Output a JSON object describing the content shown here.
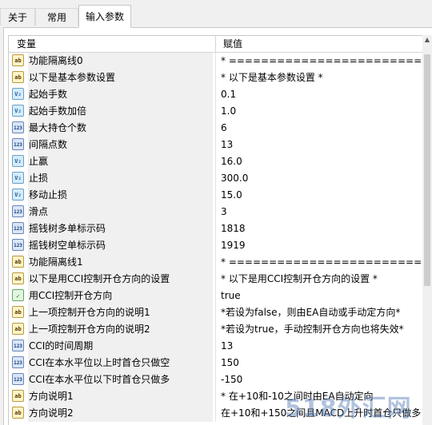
{
  "tabs": [
    {
      "label": "关于"
    },
    {
      "label": "常用"
    },
    {
      "label": "输入参数",
      "active": true
    }
  ],
  "table": {
    "columns": [
      "变量",
      "赋值"
    ],
    "rows": [
      {
        "type": "string",
        "icon": "ab",
        "name": "功能隔离线0",
        "value": "* =========================..."
      },
      {
        "type": "string",
        "icon": "ab",
        "name": "以下是基本参数设置",
        "value": "* 以下是基本参数设置 *"
      },
      {
        "type": "double",
        "icon": "V₂",
        "name": "起始手数",
        "value": "0.1"
      },
      {
        "type": "double",
        "icon": "V₂",
        "name": "起始手数加倍",
        "value": "1.0"
      },
      {
        "type": "int",
        "icon": "123",
        "name": "最大持仓个数",
        "value": "6"
      },
      {
        "type": "int",
        "icon": "123",
        "name": "间隔点数",
        "value": "13"
      },
      {
        "type": "double",
        "icon": "V₂",
        "name": "止赢",
        "value": "16.0"
      },
      {
        "type": "double",
        "icon": "V₂",
        "name": "止损",
        "value": "300.0"
      },
      {
        "type": "double",
        "icon": "V₂",
        "name": "移动止损",
        "value": "15.0"
      },
      {
        "type": "int",
        "icon": "123",
        "name": "滑点",
        "value": "3"
      },
      {
        "type": "int",
        "icon": "123",
        "name": "摇钱树多单标示码",
        "value": "1818"
      },
      {
        "type": "int",
        "icon": "123",
        "name": "摇钱树空单标示码",
        "value": "1919"
      },
      {
        "type": "string",
        "icon": "ab",
        "name": "功能隔离线1",
        "value": "* =========================..."
      },
      {
        "type": "string",
        "icon": "ab",
        "name": "以下是用CCI控制开仓方向的设置",
        "value": "* 以下是用CCI控制开仓方向的设置 *"
      },
      {
        "type": "bool",
        "icon": "✓",
        "name": "用CCI控制开仓方向",
        "value": "true"
      },
      {
        "type": "string",
        "icon": "ab",
        "name": "上一项控制开仓方向的说明1",
        "value": "*若设为false，则由EA自动或手动定方向*"
      },
      {
        "type": "string",
        "icon": "ab",
        "name": "上一项控制开仓方向的说明2",
        "value": "*若设为true，手动控制开仓方向也将失效*"
      },
      {
        "type": "int",
        "icon": "123",
        "name": "CCI的时间周期",
        "value": "13"
      },
      {
        "type": "int",
        "icon": "123",
        "name": "CCI在本水平位以上时首仓只做空",
        "value": "150"
      },
      {
        "type": "int",
        "icon": "123",
        "name": "CCI在本水平位以下时首仓只做多",
        "value": "-150"
      },
      {
        "type": "string",
        "icon": "ab",
        "name": "方向说明1",
        "value": "* 在+10和-10之间时由EA自动定向"
      },
      {
        "type": "string",
        "icon": "ab",
        "name": "方向说明2",
        "value": "在+10和+150之间且MACD上升时首仓只做多"
      }
    ]
  },
  "scrollbar": {
    "up_arrow": "▲"
  },
  "watermark": "518外汇网"
}
